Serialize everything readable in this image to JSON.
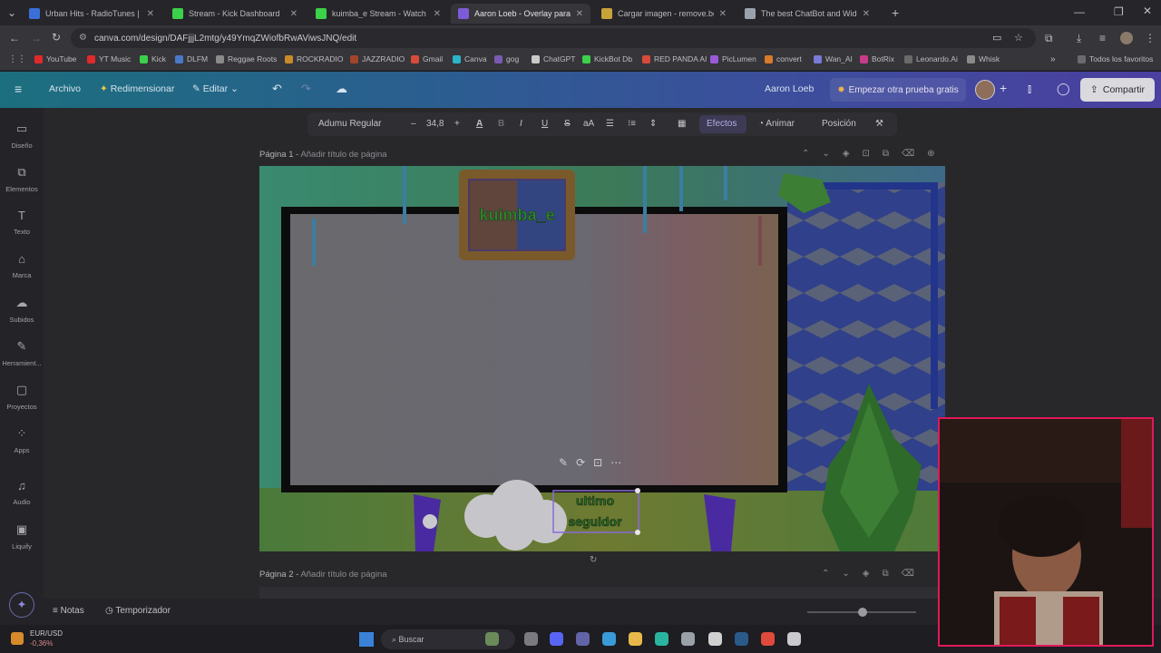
{
  "browser": {
    "tabs": [
      {
        "title": "Urban Hits - RadioTunes | F",
        "active": false,
        "color": "#3a6fd8"
      },
      {
        "title": "Stream - Kick Dashboard",
        "active": false,
        "color": "#3cd14a"
      },
      {
        "title": "kuimba_e Stream - Watch Live",
        "active": false,
        "color": "#3cd14a"
      },
      {
        "title": "Aaron Loeb - Overlay para Twi",
        "active": true,
        "color": "#7b5cd8"
      },
      {
        "title": "Cargar imagen - remove.bg",
        "active": false,
        "color": "#c7a43a"
      },
      {
        "title": "The best ChatBot and Widgets",
        "active": false,
        "color": "#9aa3ad"
      }
    ],
    "url": "canva.com/design/DAFjjjL2mtg/y49YmqZWiofbRwAViwsJNQ/edit",
    "bookmarks": [
      {
        "label": "YouTube",
        "color": "#e02a2a"
      },
      {
        "label": "YT Music",
        "color": "#e02a2a"
      },
      {
        "label": "Kick",
        "color": "#3cd14a"
      },
      {
        "label": "DLFM",
        "color": "#4a79c9"
      },
      {
        "label": "Reggae Roots",
        "color": "#8a8a8a"
      },
      {
        "label": "ROCKRADIO",
        "color": "#c78b2a"
      },
      {
        "label": "JAZZRADIO",
        "color": "#a2452a"
      },
      {
        "label": "Gmail",
        "color": "#d84a3a"
      },
      {
        "label": "Canva",
        "color": "#2ab4c9"
      },
      {
        "label": "gog",
        "color": "#7a5ab0"
      },
      {
        "label": "ChatGPT",
        "color": "#c9c9c9"
      },
      {
        "label": "KickBot Db",
        "color": "#3cd14a"
      },
      {
        "label": "RED PANDA AI",
        "color": "#d84a3a"
      },
      {
        "label": "PicLumen",
        "color": "#9a5ad8"
      },
      {
        "label": "convert",
        "color": "#d87a2a"
      },
      {
        "label": "Wan_AI",
        "color": "#7a7ad8"
      },
      {
        "label": "BotRix",
        "color": "#c93a8a"
      },
      {
        "label": "Leonardo.Ai",
        "color": "#6a6a6a"
      },
      {
        "label": "Whisk",
        "color": "#8a8a8a"
      }
    ],
    "all_bookmarks": "Todos los favoritos"
  },
  "canva": {
    "menu": {
      "file": "Archivo",
      "resize": "Redimensionar",
      "edit": "Editar"
    },
    "user": "Aaron Loeb",
    "trial": "Empezar otra prueba gratis",
    "share": "Compartir",
    "sidebar": [
      {
        "label": "Diseño",
        "icon": "layout-icon"
      },
      {
        "label": "Elementos",
        "icon": "elements-icon"
      },
      {
        "label": "Texto",
        "icon": "text-icon"
      },
      {
        "label": "Marca",
        "icon": "brand-icon"
      },
      {
        "label": "Subidos",
        "icon": "upload-icon"
      },
      {
        "label": "Herramient...",
        "icon": "tools-icon"
      },
      {
        "label": "Proyectos",
        "icon": "folder-icon"
      },
      {
        "label": "Apps",
        "icon": "apps-icon"
      },
      {
        "label": "Audio",
        "icon": "music-icon"
      },
      {
        "label": "Liquify",
        "icon": "liquify-icon"
      }
    ],
    "toolbar": {
      "font": "Adumu Regular",
      "minus": "–",
      "size": "34,8",
      "plus": "+",
      "text_color": "A",
      "bold": "B",
      "italic": "I",
      "underline": "U",
      "strike": "S",
      "case": "aA",
      "effects": "Efectos",
      "animate": "Animar",
      "position": "Posición"
    },
    "page1": {
      "label": "Página 1 -",
      "title_placeholder": "Añadir título de página"
    },
    "page2": {
      "label": "Página 2 -",
      "title_placeholder": "Añadir título de página"
    },
    "design": {
      "logo_text": "kuimba_e",
      "selected_text_line1": "ultimo",
      "selected_text_line2": "seguidor"
    },
    "bottom": {
      "notes": "Notas",
      "timer": "Temporizador"
    }
  },
  "taskbar": {
    "ticker_name": "EUR/USD",
    "ticker_change": "-0,36%",
    "search": "Buscar"
  }
}
